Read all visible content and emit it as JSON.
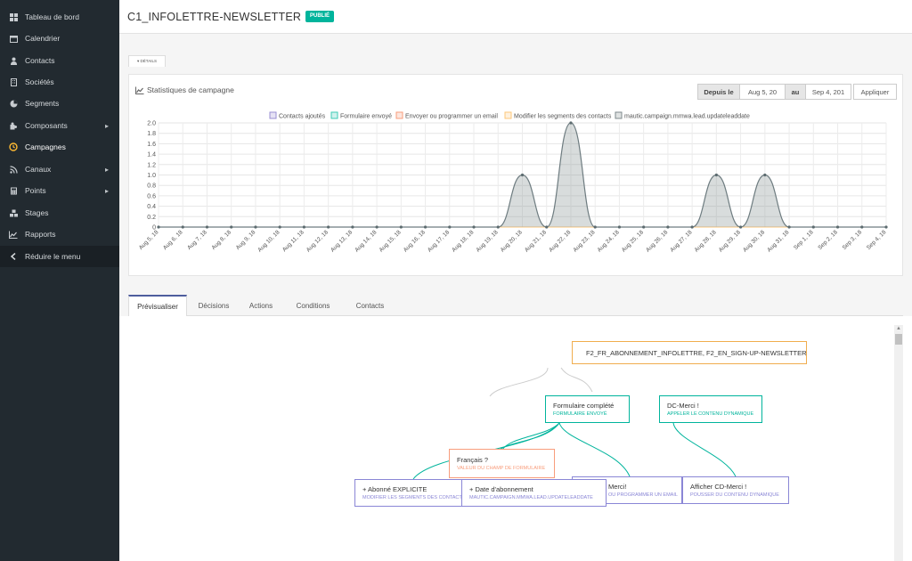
{
  "sidebar": {
    "items": [
      {
        "label": "Tableau de bord",
        "icon": "grid-icon"
      },
      {
        "label": "Calendrier",
        "icon": "calendar-icon"
      },
      {
        "label": "Contacts",
        "icon": "user-icon"
      },
      {
        "label": "Sociétés",
        "icon": "building-icon"
      },
      {
        "label": "Segments",
        "icon": "pie-chart-icon"
      },
      {
        "label": "Composants",
        "icon": "puzzle-icon"
      },
      {
        "label": "Campagnes",
        "icon": "clock-icon"
      },
      {
        "label": "Canaux",
        "icon": "rss-icon"
      },
      {
        "label": "Points",
        "icon": "calculator-icon"
      },
      {
        "label": "Stages",
        "icon": "cubes-icon"
      },
      {
        "label": "Rapports",
        "icon": "line-chart-icon"
      }
    ],
    "collapse_label": "Réduire le menu",
    "active_color": "#fdb933"
  },
  "header": {
    "title": "C1_INFOLETTRE-NEWSLETTER",
    "status": "PUBLIÉ"
  },
  "details_tab": "▾ DÉTAILS",
  "stats": {
    "title": "Statistiques de campagne",
    "since_label": "Depuis le",
    "from_date": "Aug 5, 20",
    "to_label": "au",
    "to_date": "Sep 4, 201",
    "apply_label": "Appliquer"
  },
  "chart_data": {
    "type": "area",
    "legend_position": "top",
    "grid": true,
    "ylim": [
      0,
      2.0
    ],
    "yticks": [
      "0",
      "0.2",
      "0.4",
      "0.6",
      "0.8",
      "1.0",
      "1.2",
      "1.4",
      "1.6",
      "1.8",
      "2.0"
    ],
    "categories": [
      "Aug 5, 18",
      "Aug 6, 18",
      "Aug 7, 18",
      "Aug 8, 18",
      "Aug 9, 18",
      "Aug 10, 18",
      "Aug 11, 18",
      "Aug 12, 18",
      "Aug 13, 18",
      "Aug 14, 18",
      "Aug 15, 18",
      "Aug 16, 18",
      "Aug 17, 18",
      "Aug 18, 18",
      "Aug 19, 18",
      "Aug 20, 18",
      "Aug 21, 18",
      "Aug 22, 18",
      "Aug 23, 18",
      "Aug 24, 18",
      "Aug 25, 18",
      "Aug 26, 18",
      "Aug 27, 18",
      "Aug 28, 18",
      "Aug 29, 18",
      "Aug 30, 18",
      "Aug 31, 18",
      "Sep 1, 18",
      "Sep 2, 18",
      "Sep 3, 18",
      "Sep 4, 18"
    ],
    "series": [
      {
        "name": "Contacts ajoutés",
        "color": "#9a8fd3",
        "values": [
          0,
          0,
          0,
          0,
          0,
          0,
          0,
          0,
          0,
          0,
          0,
          0,
          0,
          0,
          0,
          0,
          0,
          0,
          0,
          0,
          0,
          0,
          0,
          0,
          0,
          0,
          0,
          0,
          0,
          0,
          0
        ]
      },
      {
        "name": "Formulaire envoyé",
        "color": "#3ecbb6",
        "values": [
          0,
          0,
          0,
          0,
          0,
          0,
          0,
          0,
          0,
          0,
          0,
          0,
          0,
          0,
          0,
          0,
          0,
          0,
          0,
          0,
          0,
          0,
          0,
          0,
          0,
          0,
          0,
          0,
          0,
          0,
          0
        ]
      },
      {
        "name": "Envoyer ou programmer un email",
        "color": "#f89d7c",
        "values": [
          0,
          0,
          0,
          0,
          0,
          0,
          0,
          0,
          0,
          0,
          0,
          0,
          0,
          0,
          0,
          0,
          0,
          0,
          0,
          0,
          0,
          0,
          0,
          0,
          0,
          0,
          0,
          0,
          0,
          0,
          0
        ]
      },
      {
        "name": "Modifier les segments des contacts",
        "color": "#fdc77a",
        "values": [
          0,
          0,
          0,
          0,
          0,
          0,
          0,
          0,
          0,
          0,
          0,
          0,
          0,
          0,
          0,
          0,
          0,
          0,
          0,
          0,
          0,
          0,
          0,
          0,
          0,
          0,
          0,
          0,
          0,
          0,
          0
        ]
      },
      {
        "name": "mautic.campaign.mmwa.lead.updateleaddate",
        "color": "#7f8a8c",
        "values": [
          0,
          0,
          0,
          0,
          0,
          0,
          0,
          0,
          0,
          0,
          0,
          0,
          0,
          0,
          0,
          1,
          0,
          2,
          0,
          0,
          0,
          0,
          0,
          1,
          0,
          1,
          0,
          0,
          0,
          0,
          0
        ]
      }
    ]
  },
  "tabs": [
    {
      "label": "Prévisualiser"
    },
    {
      "label": "Décisions"
    },
    {
      "label": "Actions"
    },
    {
      "label": "Conditions"
    },
    {
      "label": "Contacts"
    }
  ],
  "builder": {
    "source": {
      "title": "F2_FR_ABONNEMENT_INFOLETTRE, F2_EN_SIGN-UP-NEWSLETTER"
    },
    "form_submitted": {
      "title": "Formulaire complété",
      "sub": "FORMULAIRE ENVOYÉ"
    },
    "dc_merci": {
      "title": "DC-Merci !",
      "sub": "APPELER LE CONTENU DYNAMIQUE"
    },
    "francais": {
      "title": "Français ?",
      "sub": "VALEUR DU CHAMP DE FORMULAIRE"
    },
    "abonne": {
      "title": "+ Abonné EXPLICITE",
      "sub": "MODIFIER LES SEGMENTS DES CONTACTS"
    },
    "date_abonnement": {
      "title": "+ Date d'abonnement",
      "sub": "MAUTIC.CAMPAIGN.MMWA.LEAD.UPDATELEADDATE"
    },
    "merci_email": {
      "title": "Merci!",
      "sub": "OU PROGRAMMER UN EMAIL"
    },
    "cd_merci": {
      "title": "Afficher CD-Merci !",
      "sub": "POUSSER DU CONTENU DYNAMIQUE"
    }
  }
}
